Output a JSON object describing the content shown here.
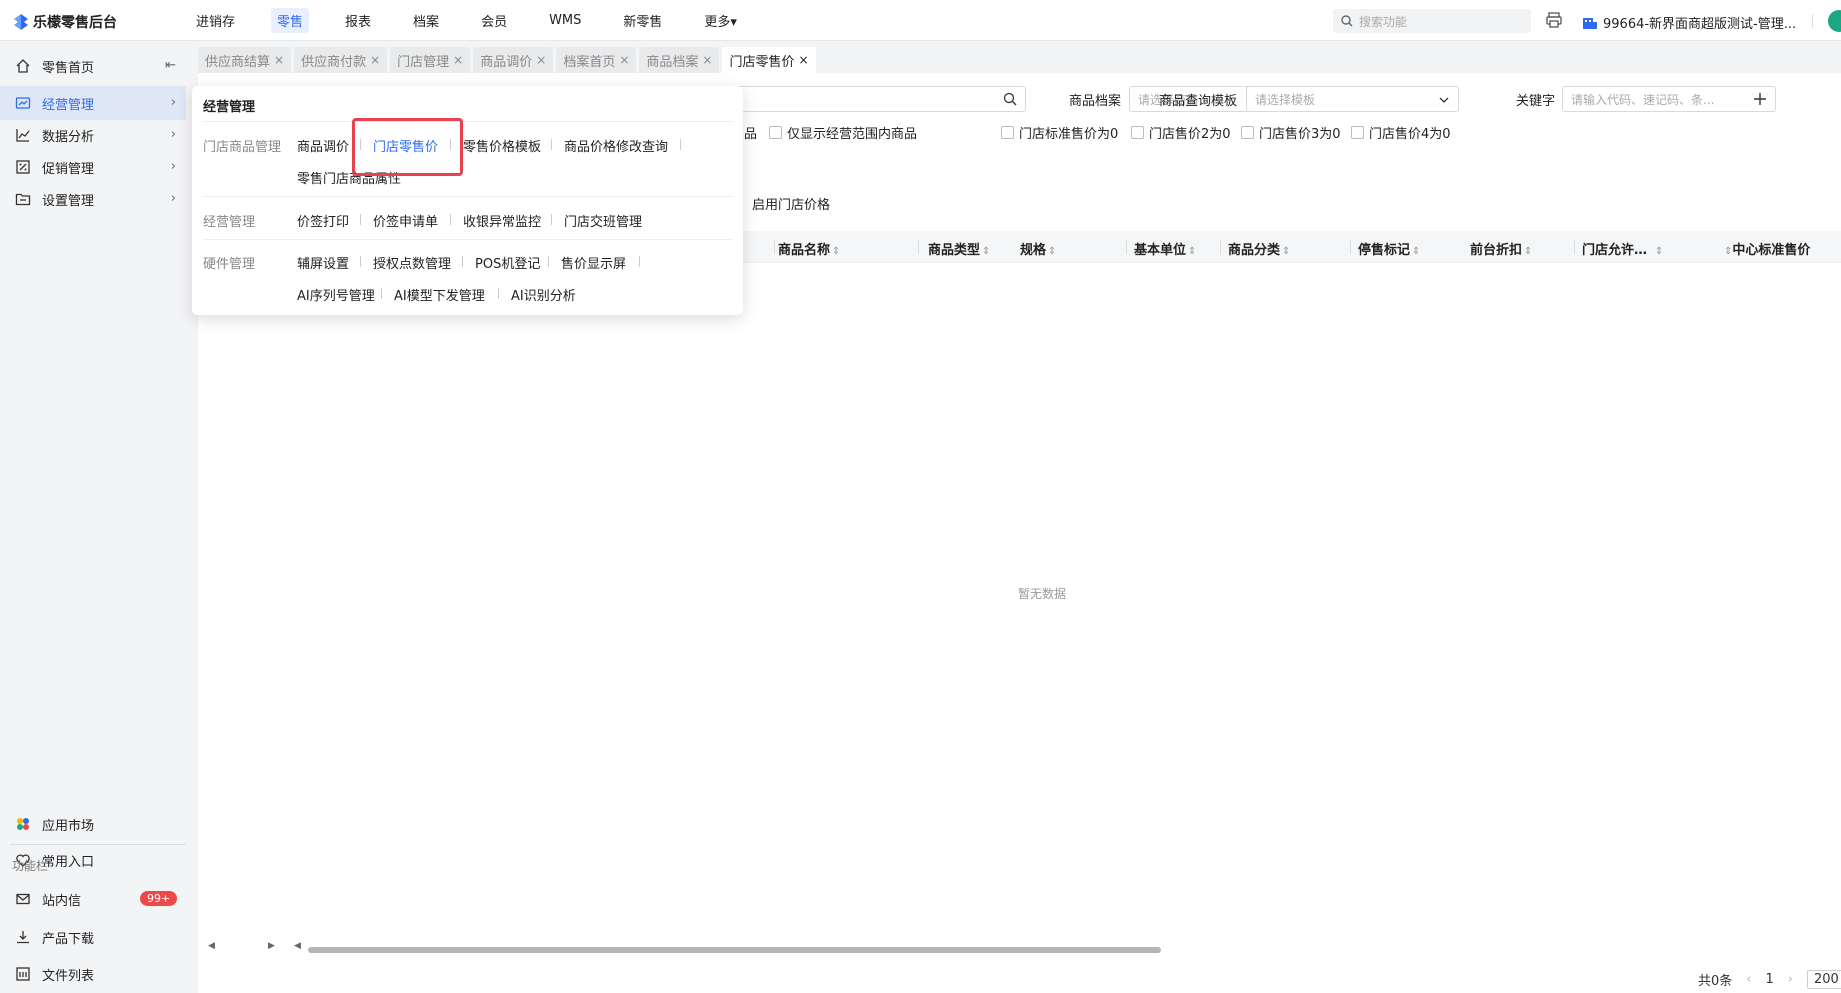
{
  "app": {
    "title": "乐檬零售后台"
  },
  "top_menu": [
    {
      "label": "进销存",
      "active": false
    },
    {
      "label": "零售",
      "active": true
    },
    {
      "label": "报表",
      "active": false
    },
    {
      "label": "档案",
      "active": false
    },
    {
      "label": "会员",
      "active": false
    },
    {
      "label": "WMS",
      "active": false
    },
    {
      "label": "新零售",
      "active": false
    },
    {
      "label": "更多▾",
      "active": false
    }
  ],
  "search": {
    "placeholder": "搜索功能"
  },
  "store": {
    "name": "99664-新界面商超版测试-管理..."
  },
  "sidebar": {
    "items": [
      {
        "label": "零售首页"
      },
      {
        "label": "经营管理"
      },
      {
        "label": "数据分析"
      },
      {
        "label": "促销管理"
      },
      {
        "label": "设置管理"
      }
    ],
    "bottom": [
      {
        "label": "应用市场"
      },
      {
        "label": "常用入口"
      }
    ],
    "section_title": "功能栏",
    "tools": [
      {
        "label": "站内信",
        "badge": "99+"
      },
      {
        "label": "产品下载"
      },
      {
        "label": "文件列表"
      }
    ]
  },
  "tabs": [
    {
      "label": "供应商结算",
      "active": false
    },
    {
      "label": "供应商付款",
      "active": false
    },
    {
      "label": "门店管理",
      "active": false
    },
    {
      "label": "商品调价",
      "active": false
    },
    {
      "label": "档案首页",
      "active": false
    },
    {
      "label": "商品档案",
      "active": false
    },
    {
      "label": "门店零售价",
      "active": true
    }
  ],
  "filters": {
    "product_label": "商品档案",
    "product_placeholder": "请选择商品",
    "template_label": "商品查询模板",
    "template_placeholder": "请选择模板",
    "keyword_label": "关键字",
    "keyword_placeholder": "请输入代码、速记码、条...",
    "partial_label": "品",
    "checkboxes": {
      "scope": "仅显示经营范围内商品",
      "std0": "门店标准售价为0",
      "p2": "门店售价2为0",
      "p3": "门店售价3为0",
      "p4": "门店售价4为0"
    },
    "enable_price": "启用门店价格"
  },
  "table": {
    "columns": [
      "商品名称",
      "商品类型",
      "规格",
      "基本单位",
      "商品分类",
      "停售标记",
      "前台折扣",
      "门店允许…",
      "中心标准售价"
    ],
    "empty_text": "暂无数据"
  },
  "pager": {
    "total": "共0条",
    "page": "1",
    "page_size": "200"
  },
  "dropdown": {
    "title": "经营管理",
    "groups": {
      "g1": "门店商品管理",
      "g2": "经营管理",
      "g3": "硬件管理"
    },
    "items": {
      "a1": "商品调价",
      "a2": "门店零售价",
      "a3": "零售价格模板",
      "a4": "商品价格修改查询",
      "a5": "零售门店商品属性",
      "b1": "价签打印",
      "b2": "价签申请单",
      "b3": "收银异常监控",
      "b4": "门店交班管理",
      "c1": "辅屏设置",
      "c2": "授权点数管理",
      "c3": "POS机登记",
      "c4": "售价显示屏",
      "c5": "AI序列号管理",
      "c6": "AI模型下发管理",
      "c7": "AI识别分析"
    }
  },
  "colors": {
    "accent": "#2f6bf0",
    "highlight": "#e8424e",
    "badge": "#f04848"
  }
}
